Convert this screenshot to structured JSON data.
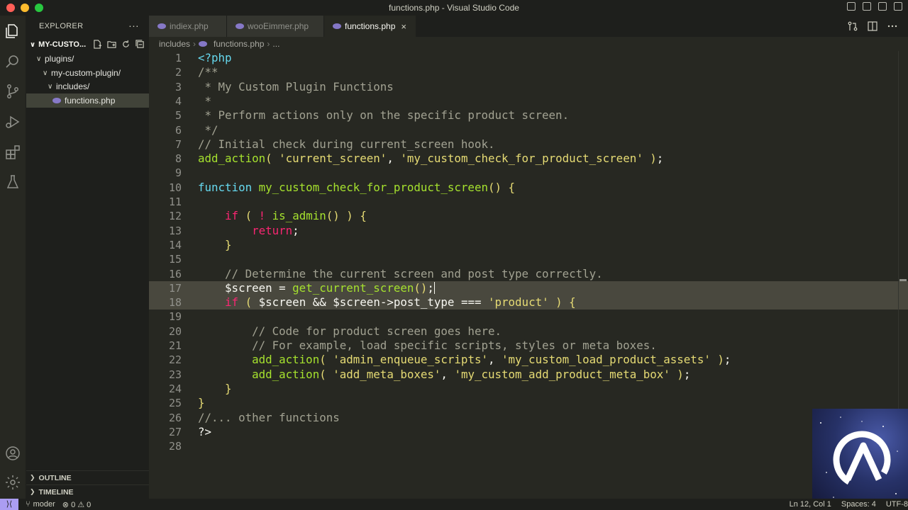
{
  "window": {
    "title": "functions.php - Visual Studio Code"
  },
  "explorer": {
    "header": "EXPLORER",
    "more": "···",
    "project": "MY-CUSTO...",
    "tree": [
      {
        "label": "plugins/",
        "chevron": "∨",
        "selected": false
      },
      {
        "label": "my-custom-plugin/",
        "chevron": "∨",
        "selected": false
      },
      {
        "label": "includes/",
        "chevron": "∨",
        "selected": false
      },
      {
        "label": "functions.php",
        "chevron": "",
        "selected": true,
        "icon": "php-file-icon"
      }
    ],
    "outline": "OUTLINE",
    "timeline": "TIMELINE"
  },
  "tabs": [
    {
      "label": "indiex.php",
      "active": false
    },
    {
      "label": "wooEimmer.php",
      "active": false
    },
    {
      "label": "functions.php",
      "active": true,
      "close": "×"
    }
  ],
  "breadcrumb": {
    "folder": "includes",
    "file": "functions.php",
    "rest": "..."
  },
  "editor": {
    "active_line": 17,
    "highlighted_lines": [
      17,
      18
    ],
    "lines": [
      {
        "n": "1",
        "tokens": [
          [
            "tag",
            "<?php"
          ]
        ]
      },
      {
        "n": "2",
        "tokens": [
          [
            "com",
            "/**"
          ]
        ]
      },
      {
        "n": "3",
        "tokens": [
          [
            "com",
            " * My Custom Plugin Functions"
          ]
        ]
      },
      {
        "n": "4",
        "tokens": [
          [
            "com",
            " *"
          ]
        ]
      },
      {
        "n": "5",
        "tokens": [
          [
            "com",
            " * Perform actions only on the specific product screen."
          ]
        ]
      },
      {
        "n": "6",
        "tokens": [
          [
            "com",
            " */"
          ]
        ]
      },
      {
        "n": "7",
        "tokens": [
          [
            "com",
            "// Initial check during current_screen hook."
          ]
        ]
      },
      {
        "n": "8",
        "tokens": [
          [
            "fn",
            "add_action"
          ],
          [
            "br",
            "("
          ],
          [
            "p",
            " "
          ],
          [
            "str",
            "'current_screen'"
          ],
          [
            "p",
            ", "
          ],
          [
            "str",
            "'my_custom_check_for_product_screen'"
          ],
          [
            "p",
            " "
          ],
          [
            "br",
            ")"
          ],
          [
            "p",
            ";"
          ]
        ]
      },
      {
        "n": "9",
        "tokens": []
      },
      {
        "n": "10",
        "tokens": [
          [
            "dec",
            "function"
          ],
          [
            "p",
            " "
          ],
          [
            "fn",
            "my_custom_check_for_product_screen"
          ],
          [
            "br",
            "()"
          ],
          [
            "p",
            " "
          ],
          [
            "br",
            "{"
          ]
        ]
      },
      {
        "n": "11",
        "tokens": []
      },
      {
        "n": "12",
        "tokens": [
          [
            "p",
            "    "
          ],
          [
            "kw",
            "if"
          ],
          [
            "p",
            " "
          ],
          [
            "br",
            "("
          ],
          [
            "p",
            " "
          ],
          [
            "kw",
            "!"
          ],
          [
            "p",
            " "
          ],
          [
            "fn",
            "is_admin"
          ],
          [
            "br",
            "()"
          ],
          [
            "p",
            " "
          ],
          [
            "br",
            ")"
          ],
          [
            "p",
            " "
          ],
          [
            "br",
            "{"
          ]
        ]
      },
      {
        "n": "13",
        "tokens": [
          [
            "p",
            "        "
          ],
          [
            "kw",
            "return"
          ],
          [
            "p",
            ";"
          ]
        ]
      },
      {
        "n": "14",
        "tokens": [
          [
            "p",
            "    "
          ],
          [
            "br",
            "}"
          ]
        ]
      },
      {
        "n": "15",
        "tokens": []
      },
      {
        "n": "16",
        "tokens": [
          [
            "p",
            "    "
          ],
          [
            "com",
            "// Determine the current screen and post type correctly."
          ]
        ]
      },
      {
        "n": "17",
        "tokens": [
          [
            "p",
            "    "
          ],
          [
            "var",
            "$screen"
          ],
          [
            "p",
            " = "
          ],
          [
            "fn",
            "get_current_screen"
          ],
          [
            "br",
            "()"
          ],
          [
            "p",
            ";"
          ],
          [
            "cursor",
            ""
          ]
        ]
      },
      {
        "n": "18",
        "tokens": [
          [
            "p",
            "    "
          ],
          [
            "kw",
            "if"
          ],
          [
            "p",
            " "
          ],
          [
            "br",
            "("
          ],
          [
            "p",
            " "
          ],
          [
            "var",
            "$screen"
          ],
          [
            "p",
            " && "
          ],
          [
            "var",
            "$screen"
          ],
          [
            "p",
            "->post_type === "
          ],
          [
            "str",
            "'product'"
          ],
          [
            "p",
            " "
          ],
          [
            "br",
            ")"
          ],
          [
            "p",
            " "
          ],
          [
            "br",
            "{"
          ]
        ]
      },
      {
        "n": "19",
        "tokens": []
      },
      {
        "n": "20",
        "tokens": [
          [
            "p",
            "        "
          ],
          [
            "com",
            "// Code for product screen goes here."
          ]
        ]
      },
      {
        "n": "21",
        "tokens": [
          [
            "p",
            "        "
          ],
          [
            "com",
            "// For example, load specific scripts, styles or meta boxes."
          ]
        ]
      },
      {
        "n": "22",
        "tokens": [
          [
            "p",
            "        "
          ],
          [
            "fn",
            "add_action"
          ],
          [
            "br",
            "("
          ],
          [
            "p",
            " "
          ],
          [
            "str",
            "'admin_enqueue_scripts'"
          ],
          [
            "p",
            ", "
          ],
          [
            "str",
            "'my_custom_load_product_assets'"
          ],
          [
            "p",
            " "
          ],
          [
            "br",
            ")"
          ],
          [
            "p",
            ";"
          ]
        ]
      },
      {
        "n": "23",
        "tokens": [
          [
            "p",
            "        "
          ],
          [
            "fn",
            "add_action"
          ],
          [
            "br",
            "("
          ],
          [
            "p",
            " "
          ],
          [
            "str",
            "'add_meta_boxes'"
          ],
          [
            "p",
            ", "
          ],
          [
            "str",
            "'my_custom_add_product_meta_box'"
          ],
          [
            "p",
            " "
          ],
          [
            "br",
            ")"
          ],
          [
            "p",
            ";"
          ]
        ]
      },
      {
        "n": "24",
        "tokens": [
          [
            "p",
            "    "
          ],
          [
            "br",
            "}"
          ]
        ]
      },
      {
        "n": "25",
        "tokens": [
          [
            "br",
            "}"
          ]
        ]
      },
      {
        "n": "26",
        "tokens": [
          [
            "com",
            "//... other functions"
          ]
        ]
      },
      {
        "n": "27",
        "tokens": [
          [
            "p",
            "?>"
          ]
        ]
      },
      {
        "n": "28",
        "tokens": []
      }
    ]
  },
  "status": {
    "remote": "⟩⟨",
    "branch": "moder",
    "problems": "⊗ 0 ⚠ 0",
    "position": "Ln 12, Col 1",
    "spaces": "Spaces: 4",
    "encoding": "UTF-8"
  },
  "colors": {
    "editor_bg": "#272822",
    "sidebar_bg": "#1e1f1c",
    "keyword": "#f92672",
    "function": "#a6e22e",
    "string": "#e6db74",
    "comment": "#a2a292",
    "storage": "#66d9ef"
  }
}
